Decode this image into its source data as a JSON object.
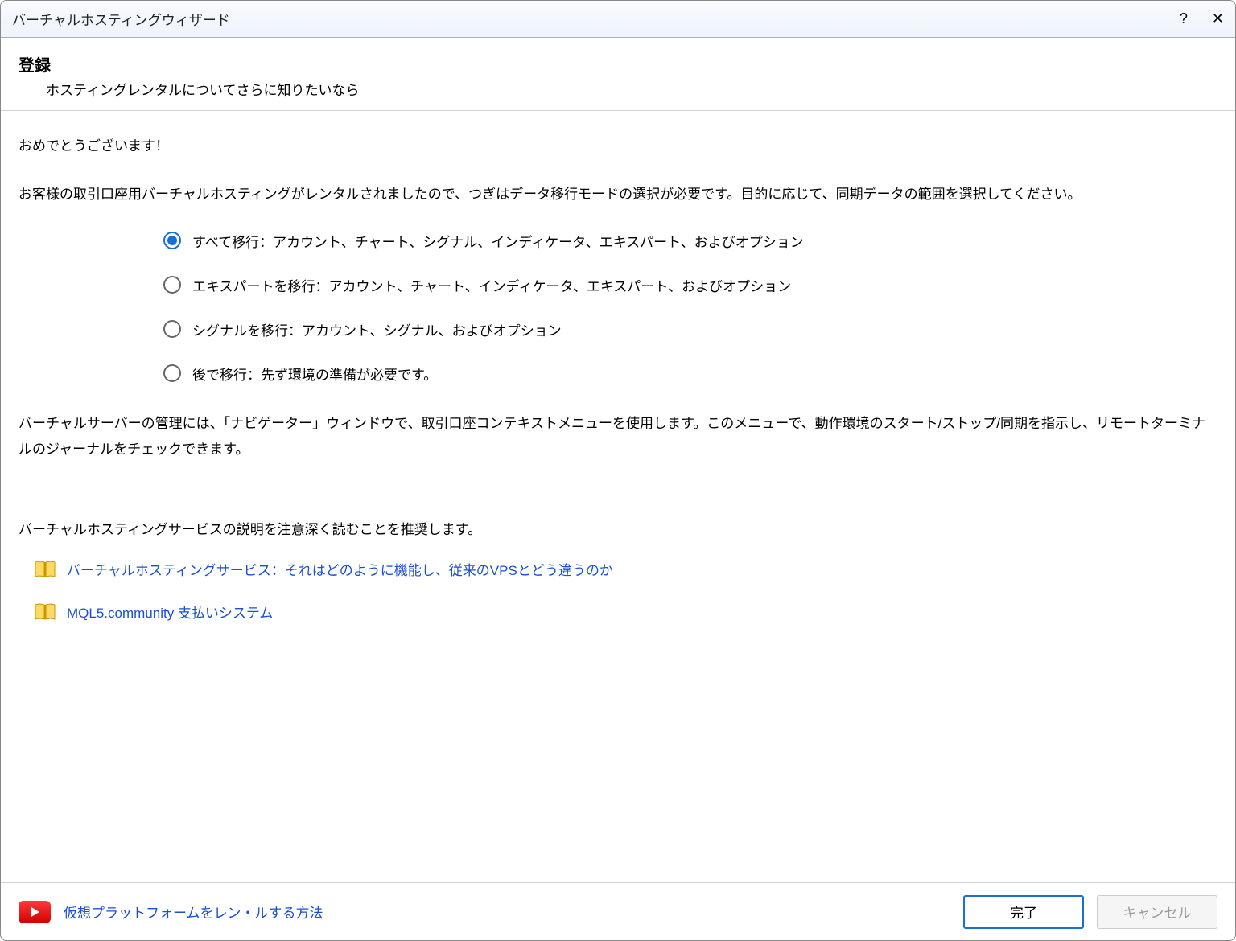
{
  "window": {
    "title": "バーチャルホスティングウィザード"
  },
  "header": {
    "title": "登録",
    "subtitle": "ホスティングレンタルについてさらに知りたいなら"
  },
  "content": {
    "congrats": "おめでとうございます！",
    "intro": "お客様の取引口座用バーチャルホスティングがレンタルされましたので、つぎはデータ移行モードの選択が必要です。目的に応じて、同期データの範囲を選択してください。",
    "options": [
      {
        "label": "すべて移行：アカウント、チャート、シグナル、インディケータ、エキスパート、およびオプション",
        "selected": true
      },
      {
        "label": "エキスパートを移行：アカウント、チャート、インディケータ、エキスパート、およびオプション",
        "selected": false
      },
      {
        "label": "シグナルを移行：アカウント、シグナル、およびオプション",
        "selected": false
      },
      {
        "label": "後で移行：先ず環境の準備が必要です。",
        "selected": false
      }
    ],
    "manage_note": "バーチャルサーバーの管理には、「ナビゲーター」ウィンドウで、取引口座コンテキストメニューを使用します。このメニューで、動作環境のスタート/ストップ/同期を指示し、リモートターミナルのジャーナルをチェックできます。",
    "recommend": "バーチャルホスティングサービスの説明を注意深く読むことを推奨します。",
    "links": [
      {
        "label": "バーチャルホスティングサービス：それはどのように機能し、従来のVPSとどう違うのか"
      },
      {
        "label": "MQL5.community 支払いシステム"
      }
    ]
  },
  "footer": {
    "video_link": "仮想プラットフォームをレン・ルする方法",
    "ok": "完了",
    "cancel": "キャンセル"
  }
}
